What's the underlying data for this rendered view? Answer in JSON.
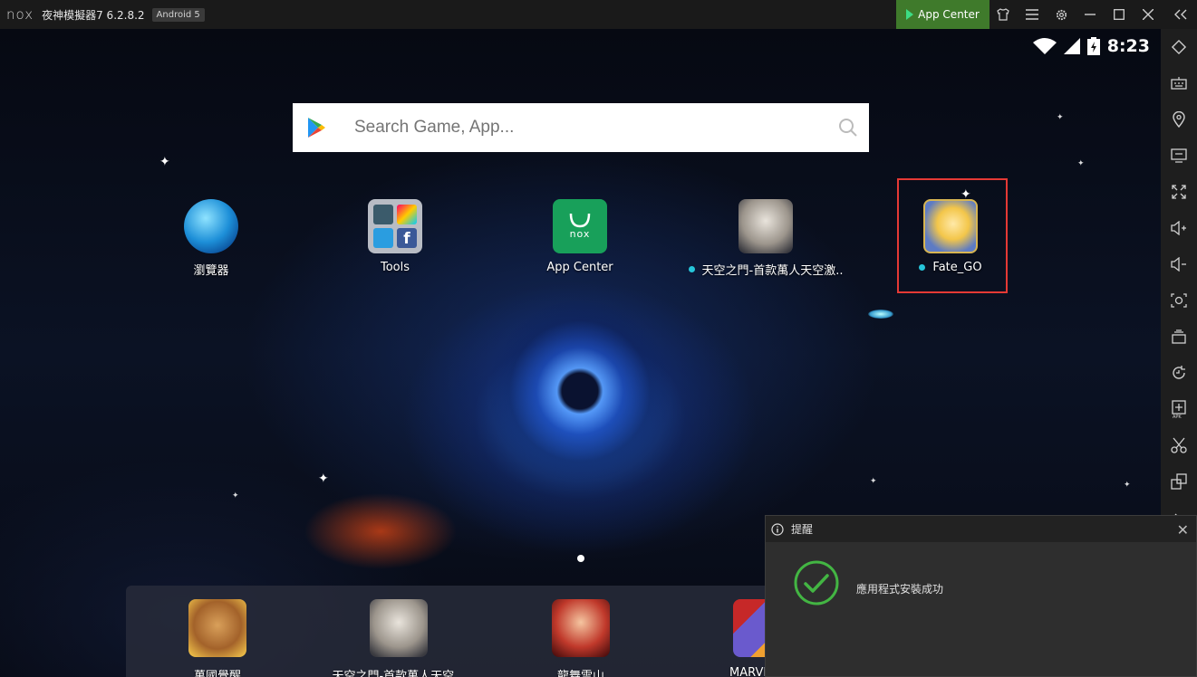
{
  "titlebar": {
    "logo": "nox",
    "title": "夜神模擬器7 6.2.8.2",
    "android_badge": "Android 5",
    "app_center_label": "App Center",
    "accent_color": "#3f7a2b"
  },
  "statusbar": {
    "time": "8:23"
  },
  "search": {
    "placeholder": "Search Game, App..."
  },
  "apps": [
    {
      "label": "瀏覽器",
      "new_dot": false,
      "icon": "globe-browser-icon"
    },
    {
      "label": "Tools",
      "new_dot": false,
      "icon": "tools-folder-icon"
    },
    {
      "label": "App Center",
      "new_dot": false,
      "icon": "nox-app-center-icon"
    },
    {
      "label": "天空之門-首款萬人天空激..",
      "new_dot": true,
      "icon": "game-portrait-icon"
    },
    {
      "label": "Fate_GO",
      "new_dot": true,
      "icon": "fate-go-icon",
      "highlighted": true
    }
  ],
  "dock": [
    {
      "label": "萬國覺醒",
      "icon": "rise-of-kingdoms-icon"
    },
    {
      "label": "天空之門-首款萬人天空...",
      "icon": "game-portrait-icon"
    },
    {
      "label": "龍舞雲山",
      "icon": "dragon-dance-icon"
    },
    {
      "label": "MARVEL Fu",
      "icon": "marvel-future-fight-icon"
    }
  ],
  "sidebar": [
    "rotate-icon",
    "keyboard-icon",
    "location-icon",
    "screen-icon",
    "fullscreen-icon",
    "volume-up-icon",
    "volume-down-icon",
    "screenshot-icon",
    "multi-instance-icon",
    "macro-icon",
    "apk-install-icon",
    "scissors-icon",
    "multi-window-icon",
    "more-icon"
  ],
  "notification": {
    "title": "提醒",
    "message": "應用程式安裝成功",
    "success_color": "#43b543"
  }
}
